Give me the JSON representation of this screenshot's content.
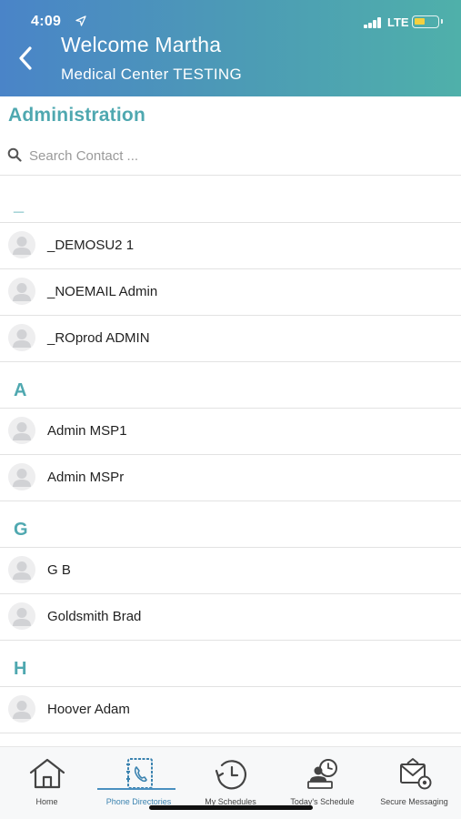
{
  "status_bar": {
    "time": "4:09",
    "network": "LTE"
  },
  "header": {
    "title": "Welcome Martha",
    "subtitle": "Medical Center TESTING"
  },
  "section": {
    "title": "Administration"
  },
  "search": {
    "placeholder": "Search Contact ...",
    "value": ""
  },
  "contacts": {
    "groups": [
      {
        "letter": "_",
        "items": [
          "_DEMOSU2 1",
          "_NOEMAIL Admin",
          "_ROprod ADMIN"
        ]
      },
      {
        "letter": "A",
        "items": [
          "Admin MSP1",
          "Admin MSPr"
        ]
      },
      {
        "letter": "G",
        "items": [
          "G B",
          "Goldsmith Brad"
        ]
      },
      {
        "letter": "H",
        "items": [
          "Hoover Adam"
        ]
      }
    ]
  },
  "tabbar": {
    "active": "Phone Directories",
    "items": [
      {
        "label": "Home",
        "icon": "home-icon"
      },
      {
        "label": "Phone Directories",
        "icon": "phone-directory-icon"
      },
      {
        "label": "My Schedules",
        "icon": "clock-history-icon"
      },
      {
        "label": "Today's Schedule",
        "icon": "schedule-person-icon"
      },
      {
        "label": "Secure Messaging",
        "icon": "secure-mail-icon"
      }
    ]
  },
  "colors": {
    "accent": "#4fa8b0",
    "header_start": "#4a84c8",
    "header_end": "#4fb0aa",
    "battery": "#f4d03f",
    "active_tab": "#3b83b0"
  }
}
